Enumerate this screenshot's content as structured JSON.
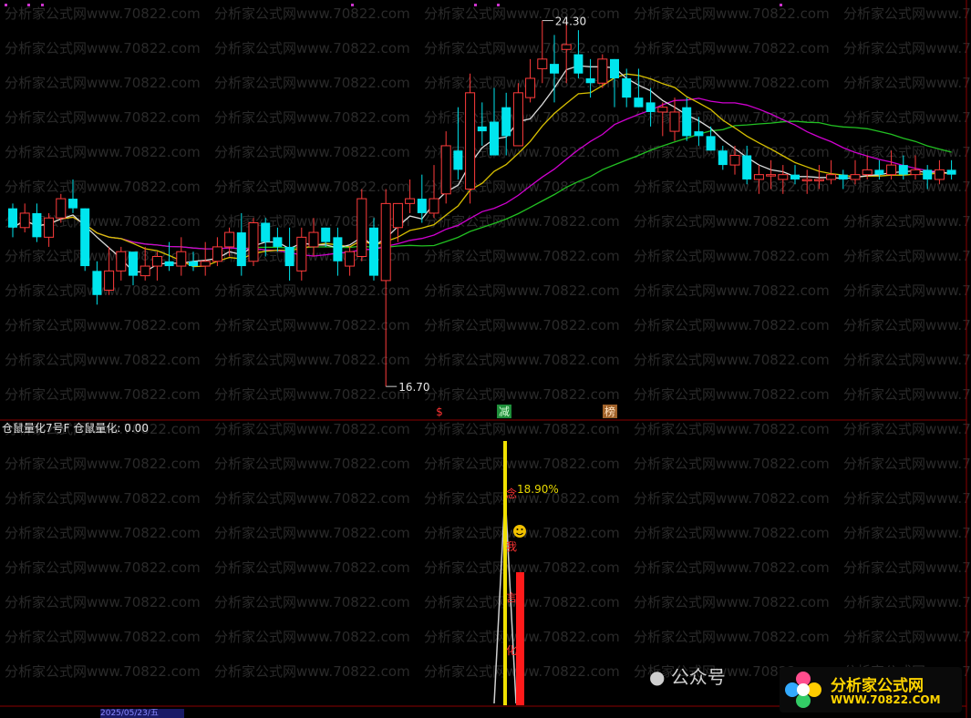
{
  "main_panel": {
    "high_label": "24.30",
    "low_label": "16.70",
    "signal_labels": [
      "$",
      "减",
      "榜"
    ]
  },
  "sub_panel": {
    "indicator_title": "仓鼠量化7号F",
    "indicator_value_label": "仓鼠量化: 0.00",
    "pct_label": "18.90%",
    "vertical_glyphs": [
      "念",
      "我",
      "言",
      "化"
    ]
  },
  "bottom_bar": {
    "date_label": "2025/05/23/五"
  },
  "wechat_label": "公众号",
  "watermark": {
    "site_name": "分析家公式网",
    "url": "WWW.70822.COM",
    "bg_text": "分析家公式网www.70822.com"
  },
  "colors": {
    "up_candle": "#ff3b3b",
    "down_candle": "#00e5ee",
    "ma_white": "#dcdcdc",
    "ma_yellow": "#d8c000",
    "ma_magenta": "#d000d0",
    "ma_green": "#22c022"
  },
  "candles": [
    [
      20.4,
      20.0,
      20.5,
      19.8
    ],
    [
      20.0,
      20.3,
      20.5,
      19.9
    ],
    [
      20.3,
      19.8,
      20.5,
      19.7
    ],
    [
      19.8,
      20.2,
      20.3,
      19.6
    ],
    [
      20.2,
      20.6,
      20.7,
      20.1
    ],
    [
      20.6,
      20.4,
      21.0,
      20.3
    ],
    [
      20.4,
      19.2,
      20.4,
      19.1
    ],
    [
      19.1,
      18.6,
      19.3,
      18.4
    ],
    [
      18.7,
      19.1,
      19.6,
      18.6
    ],
    [
      19.1,
      19.5,
      19.6,
      18.9
    ],
    [
      19.5,
      19.0,
      19.5,
      18.8
    ],
    [
      19.0,
      19.2,
      19.6,
      18.9
    ],
    [
      19.2,
      19.4,
      19.5,
      18.9
    ],
    [
      19.3,
      19.2,
      19.7,
      19.1
    ],
    [
      19.2,
      19.5,
      19.8,
      19.0
    ],
    [
      19.3,
      19.2,
      19.5,
      19.1
    ],
    [
      19.2,
      19.3,
      19.7,
      19.0
    ],
    [
      19.3,
      19.6,
      19.8,
      19.2
    ],
    [
      19.6,
      19.9,
      20.0,
      19.4
    ],
    [
      19.9,
      19.2,
      20.3,
      19.0
    ],
    [
      19.3,
      20.1,
      20.2,
      19.2
    ],
    [
      20.1,
      19.7,
      20.2,
      19.4
    ],
    [
      19.8,
      19.6,
      20.0,
      19.5
    ],
    [
      19.6,
      19.2,
      20.0,
      18.9
    ],
    [
      19.1,
      19.8,
      20.0,
      18.9
    ],
    [
      19.6,
      19.9,
      20.2,
      19.4
    ],
    [
      20.0,
      19.7,
      20.0,
      19.6
    ],
    [
      19.8,
      19.3,
      20.0,
      19.0
    ],
    [
      19.2,
      19.5,
      19.6,
      19.0
    ],
    [
      19.4,
      20.6,
      20.8,
      19.3
    ],
    [
      20.0,
      19.0,
      20.2,
      18.9
    ],
    [
      18.9,
      20.5,
      20.8,
      16.7
    ],
    [
      20.0,
      20.5,
      20.5,
      19.7
    ],
    [
      20.5,
      20.6,
      21.0,
      20.3
    ],
    [
      20.6,
      20.3,
      21.1,
      20.1
    ],
    [
      20.3,
      20.6,
      21.3,
      20.2
    ],
    [
      20.7,
      21.7,
      22.0,
      20.5
    ],
    [
      21.6,
      21.2,
      22.5,
      21.0
    ],
    [
      20.8,
      22.8,
      23.2,
      20.5
    ],
    [
      22.1,
      22.0,
      22.6,
      21.7
    ],
    [
      22.2,
      21.5,
      22.9,
      21.5
    ],
    [
      22.5,
      21.9,
      22.8,
      21.5
    ],
    [
      21.7,
      22.8,
      23.0,
      21.8
    ],
    [
      22.7,
      23.1,
      23.5,
      22.6
    ],
    [
      23.3,
      23.5,
      24.3,
      23.0
    ],
    [
      23.4,
      23.2,
      24.0,
      22.6
    ],
    [
      23.7,
      23.8,
      24.3,
      23.0
    ],
    [
      23.6,
      23.2,
      24.1,
      23.1
    ],
    [
      23.1,
      23.0,
      23.5,
      22.7
    ],
    [
      23.0,
      23.5,
      23.6,
      22.9
    ],
    [
      23.5,
      23.1,
      23.5,
      22.5
    ],
    [
      23.1,
      22.7,
      23.3,
      22.5
    ],
    [
      22.7,
      22.5,
      23.3,
      22.5
    ],
    [
      22.6,
      22.4,
      22.9,
      22.1
    ],
    [
      22.4,
      22.5,
      22.6,
      21.9
    ],
    [
      22.0,
      22.4,
      22.7,
      21.8
    ],
    [
      22.5,
      21.9,
      22.7,
      21.8
    ],
    [
      22.0,
      21.9,
      22.3,
      21.7
    ],
    [
      21.9,
      21.6,
      22.1,
      21.6
    ],
    [
      21.6,
      21.3,
      21.7,
      21.2
    ],
    [
      21.3,
      21.5,
      21.7,
      21.1
    ],
    [
      21.5,
      21.0,
      21.7,
      20.9
    ],
    [
      21.0,
      21.1,
      21.3,
      20.7
    ],
    [
      21.1,
      21.1,
      21.4,
      20.8
    ],
    [
      21.0,
      21.1,
      21.3,
      20.7
    ],
    [
      21.1,
      21.0,
      21.3,
      20.9
    ],
    [
      21.0,
      21.0,
      21.2,
      20.7
    ],
    [
      21.0,
      21.0,
      21.3,
      20.8
    ],
    [
      21.0,
      21.1,
      21.4,
      20.9
    ],
    [
      21.1,
      21.0,
      21.2,
      20.8
    ],
    [
      21.0,
      21.1,
      21.4,
      20.9
    ],
    [
      21.1,
      21.2,
      21.5,
      21.0
    ],
    [
      21.2,
      21.1,
      21.4,
      21.0
    ],
    [
      21.1,
      21.3,
      21.6,
      21.0
    ],
    [
      21.3,
      21.1,
      21.5,
      21.0
    ],
    [
      21.1,
      21.2,
      21.5,
      21.0
    ],
    [
      21.2,
      21.0,
      21.3,
      20.8
    ],
    [
      21.0,
      21.2,
      21.4,
      20.9
    ],
    [
      21.2,
      21.1,
      21.4,
      21.0
    ]
  ]
}
